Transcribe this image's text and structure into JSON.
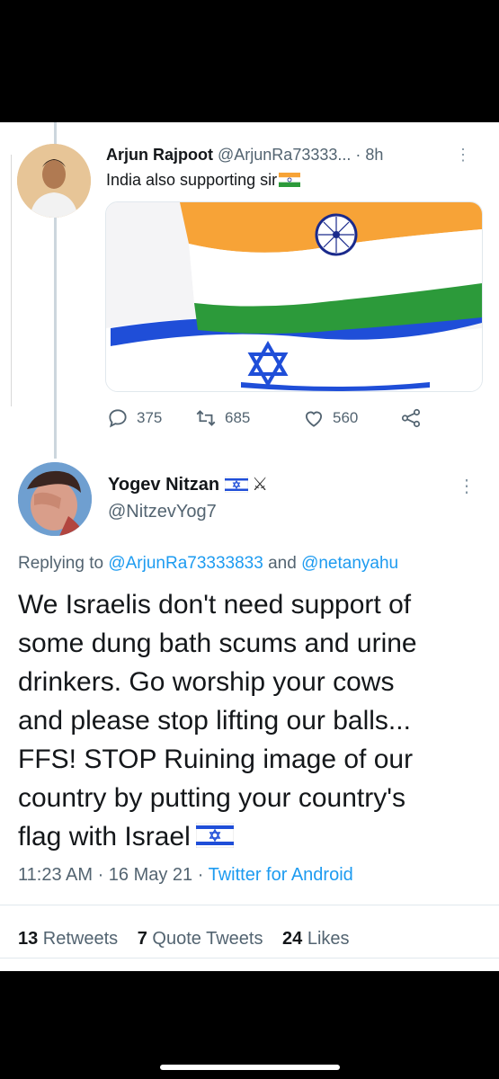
{
  "tweet1": {
    "name": "Arjun Rajpoot",
    "handle": "@ArjunRa73333...",
    "time": "· 8h",
    "more": "⋮",
    "text": "India also supporting sir",
    "replies": "375",
    "retweets": "685",
    "likes": "560"
  },
  "tweet2": {
    "name": "Yogev Nitzan",
    "swords": "⚔",
    "handle": "@NitzevYog7",
    "more": "⋮",
    "replying_prefix": "Replying to ",
    "reply_user1": "@ArjunRa73333833",
    "reply_and": " and ",
    "reply_user2": "@netanyahu",
    "lines": [
      "We Israelis don't need support of",
      "some dung bath scums and urine",
      "drinkers. Go worship your cows",
      "and please stop lifting our balls...",
      "FFS! STOP Ruining image of our",
      "country by putting your country's",
      "flag with Israel"
    ],
    "time": "11:23 AM · 16 May 21 · ",
    "source": "Twitter for Android",
    "stats": {
      "retweets_count": "13",
      "retweets_label": " Retweets",
      "quotes_count": "7",
      "quotes_label": " Quote Tweets",
      "likes_count": "24",
      "likes_label": " Likes"
    }
  },
  "colors": {
    "accent": "#1d9bf0",
    "muted": "#536471",
    "text": "#14171a",
    "saffron": "#f7a337",
    "green": "#2c9a3a",
    "israel_blue": "#1f4ed8"
  },
  "icons": {
    "reply": "reply-icon",
    "retweet": "retweet-icon",
    "like": "heart-icon",
    "share": "share-icon"
  }
}
